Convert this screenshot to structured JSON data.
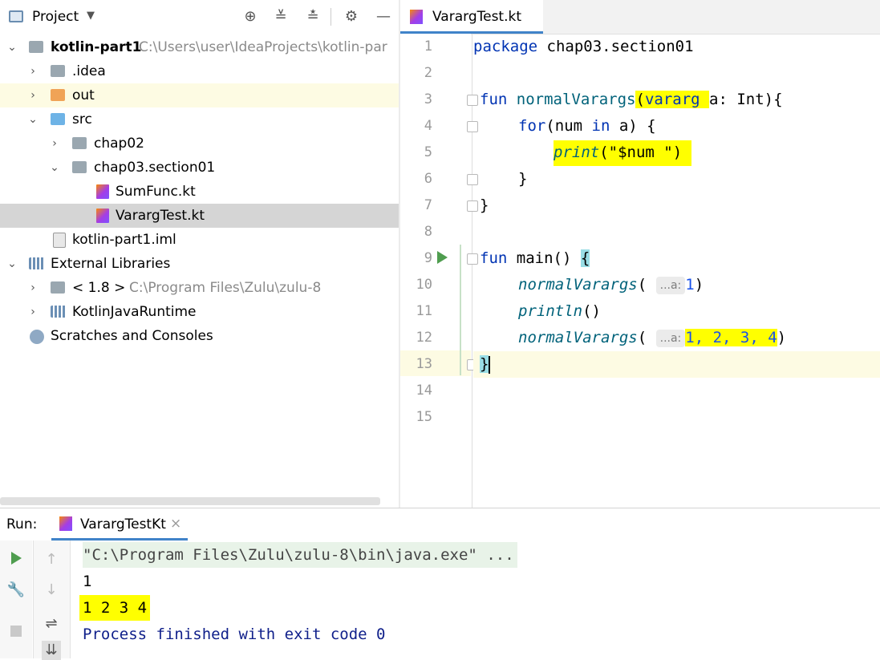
{
  "project_panel": {
    "title": "Project",
    "tree": [
      {
        "label": "kotlin-part1",
        "hint": "C:\\Users\\user\\IdeaProjects\\kotlin-par"
      },
      {
        "label": ".idea"
      },
      {
        "label": "out"
      },
      {
        "label": "src"
      },
      {
        "label": "chap02"
      },
      {
        "label": "chap03.section01"
      },
      {
        "label": "SumFunc.kt"
      },
      {
        "label": "VarargTest.kt"
      },
      {
        "label": "kotlin-part1.iml"
      },
      {
        "label": "External Libraries"
      },
      {
        "label": "< 1.8 >",
        "hint": "C:\\Program Files\\Zulu\\zulu-8"
      },
      {
        "label": "KotlinJavaRuntime"
      },
      {
        "label": "Scratches and Consoles"
      }
    ]
  },
  "editor": {
    "tab_label": "VarargTest.kt",
    "line_numbers": [
      "1",
      "2",
      "3",
      "4",
      "5",
      "6",
      "7",
      "8",
      "9",
      "10",
      "11",
      "12",
      "13",
      "14",
      "15"
    ],
    "code": {
      "l1_kw": "package",
      "l1_rest": " chap03.section01",
      "l3_kw": "fun",
      "l3_name": " normalVarargs",
      "l3_open": "(",
      "l3_vararg": "vararg ",
      "l3_rest": "a: Int){",
      "l4_for": "for",
      "l4_mid": "(num ",
      "l4_in": "in",
      "l4_rest": " a) {",
      "l5_print": "print",
      "l5_open": "(",
      "l5_str": "\"$num \"",
      "l5_close": ")",
      "l6": "}",
      "l7": "}",
      "l9_kw": "fun",
      "l9_rest": " main() ",
      "l9_brace": "{",
      "l10_call": "normalVarargs",
      "l10_open": "(",
      "l10_hint": "...a:",
      "l10_arg": "1",
      "l10_close": ")",
      "l11_call": "println",
      "l11_rest": "()",
      "l12_call": "normalVarargs",
      "l12_open": "(",
      "l12_hint": "...a:",
      "l12_args": "1, 2, 3, 4",
      "l12_close": ")",
      "l13": "}"
    }
  },
  "run_panel": {
    "label": "Run:",
    "tab_label": "VarargTestKt",
    "tab_close": "×",
    "console": {
      "cmd": "\"C:\\Program Files\\Zulu\\zulu-8\\bin\\java.exe\" ...",
      "out1": "1",
      "out2": "1 2 3 4",
      "exit": "Process finished with exit code 0"
    }
  },
  "colors": {
    "highlight": "#ffff00",
    "keyword": "#0033b3",
    "function": "#00627a",
    "number": "#1750eb",
    "string": "#067d17",
    "accent": "#4083c9"
  },
  "icons": [
    "project-view-icon",
    "dropdown-icon",
    "locate-icon",
    "expand-all-icon",
    "collapse-all-icon",
    "gear-icon",
    "hide-icon",
    "run-icon",
    "wrench-icon",
    "stop-icon",
    "up-arrow-icon",
    "down-arrow-icon",
    "soft-wrap-icon",
    "scroll-to-end-icon"
  ]
}
